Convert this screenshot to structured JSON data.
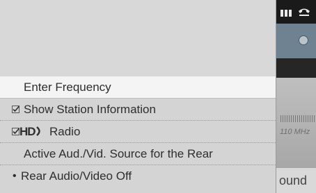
{
  "menu": {
    "items": [
      {
        "label": "Enter Frequency",
        "selected": true
      },
      {
        "label": "Show Station Information",
        "checked": true
      },
      {
        "logo_text": "HD",
        "label": "Radio",
        "checked": true
      },
      {
        "label": "Active Aud./Vid. Source for the Rear"
      },
      {
        "label": "Rear Audio/Video Off",
        "bullet": "•"
      }
    ]
  },
  "background": {
    "frequency_text": "110 MHz",
    "sound_label": "ound",
    "icons": [
      "signal-icon",
      "phone-icon",
      "globe-icon"
    ]
  },
  "colors": {
    "menu_bg": "#d4d4d4",
    "selected_bg": "#f4f4f4",
    "text": "#2e2e2e",
    "accent_blue": "#6f8292"
  }
}
